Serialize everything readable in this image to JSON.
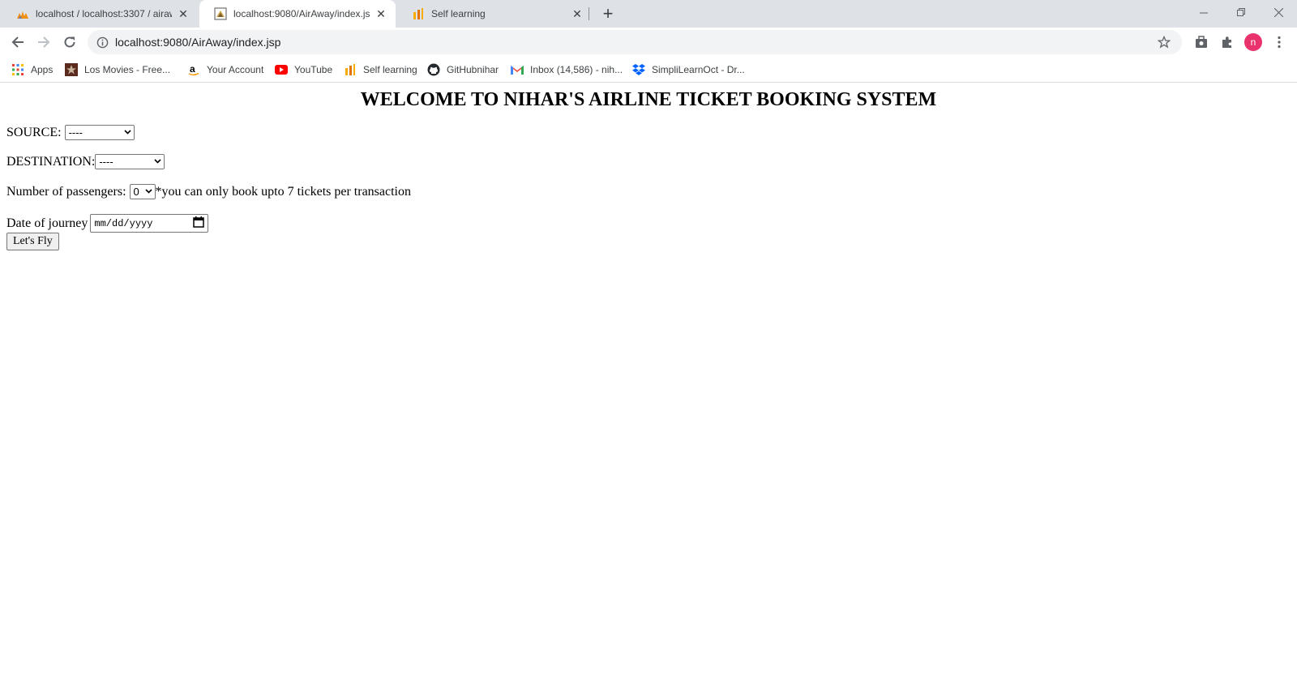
{
  "browser": {
    "tabs": [
      {
        "title": "localhost / localhost:3307 / airaw",
        "favicon": "phpmyadmin-icon",
        "active": false
      },
      {
        "title": "localhost:9080/AirAway/index.jsp",
        "favicon": "page-favicon-icon",
        "active": true
      },
      {
        "title": "Self learning",
        "favicon": "analytics-icon",
        "active": false
      }
    ],
    "url": "localhost:9080/AirAway/index.jsp",
    "avatar_letter": "n",
    "avatar_color": "#e8336d"
  },
  "bookmarks": [
    {
      "label": "Apps",
      "icon": "apps-grid-icon"
    },
    {
      "label": "Los Movies - Free...",
      "icon": "movie-icon"
    },
    {
      "label": "Your Account",
      "icon": "amazon-icon"
    },
    {
      "label": "YouTube",
      "icon": "youtube-icon"
    },
    {
      "label": "Self learning",
      "icon": "analytics-icon"
    },
    {
      "label": "GitHubnihar",
      "icon": "github-icon"
    },
    {
      "label": "Inbox (14,586) - nih...",
      "icon": "gmail-icon"
    },
    {
      "label": "SimpliLearnOct - Dr...",
      "icon": "dropbox-icon"
    }
  ],
  "page": {
    "heading": "WELCOME TO NIHAR'S AIRLINE TICKET BOOKING SYSTEM",
    "source_label": "SOURCE:",
    "source_value": "----",
    "destination_label": "DESTINATION:",
    "destination_value": "----",
    "passengers_label": "Number of passengers:",
    "passengers_value": "0",
    "passengers_note": "*you can only book upto 7 tickets per transaction",
    "date_label": "Date of journey",
    "date_placeholder": "mm/dd/yyyy",
    "submit_label": "Let's Fly"
  }
}
